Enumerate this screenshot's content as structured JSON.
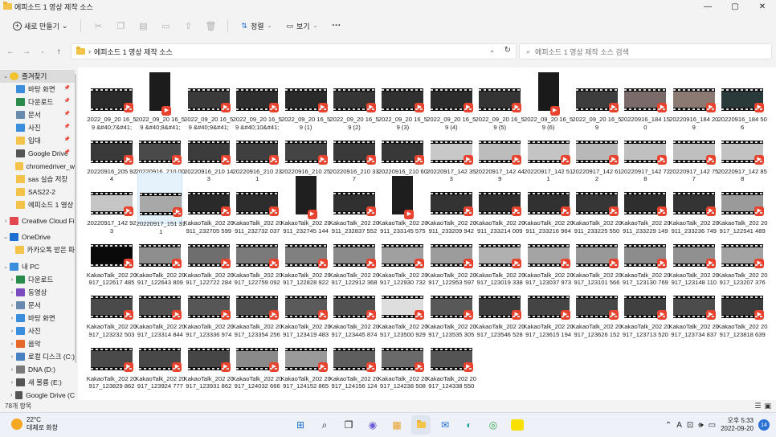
{
  "window": {
    "title": "에피소드 1 영상 제작 소스",
    "min": "—",
    "max": "▢",
    "close": "✕"
  },
  "toolbar": {
    "new": "새로 만들기",
    "sort": "정렬",
    "view": "보기",
    "more": "···"
  },
  "address": {
    "path": "에피소드 1 영상 제작 소스",
    "search_placeholder": "에피소드 1 영상 제작 소스 검색"
  },
  "sidebar": {
    "items": [
      {
        "label": "즐겨찾기",
        "icon": "star-icon",
        "color": "#f4c430",
        "level": 0,
        "arrow": "⌄",
        "selected": true
      },
      {
        "label": "바탕 화면",
        "icon": "desktop-icon",
        "color": "#3b8ede",
        "level": 1,
        "pin": true
      },
      {
        "label": "다운로드",
        "icon": "download-icon",
        "color": "#2a8c4a",
        "level": 1,
        "pin": true
      },
      {
        "label": "문서",
        "icon": "document-icon",
        "color": "#6a8bb0",
        "level": 1,
        "pin": true
      },
      {
        "label": "사진",
        "icon": "picture-icon",
        "color": "#3b8ede",
        "level": 1,
        "pin": true
      },
      {
        "label": "입대",
        "icon": "folder-icon",
        "color": "#f4c34a",
        "level": 1,
        "pin": true
      },
      {
        "label": "Google Drive",
        "icon": "drive-icon",
        "color": "#555555",
        "level": 1,
        "pin": true
      },
      {
        "label": "chromedriver_w",
        "icon": "folder-icon",
        "color": "#f4c34a",
        "level": 1
      },
      {
        "label": "sas 실습 저장",
        "icon": "folder-icon",
        "color": "#f4c34a",
        "level": 1
      },
      {
        "label": "SAS22-2",
        "icon": "folder-icon",
        "color": "#f4c34a",
        "level": 1
      },
      {
        "label": "에피소드 1 영상",
        "icon": "folder-icon",
        "color": "#f4c34a",
        "level": 1
      },
      {
        "label": "Creative Cloud Fi",
        "icon": "cloud-icon",
        "color": "#e34850",
        "level": 0,
        "arrow": "›"
      },
      {
        "label": "OneDrive",
        "icon": "cloud-icon",
        "color": "#1e6fd0",
        "level": 0,
        "arrow": "⌄"
      },
      {
        "label": "카카오톡 받은 파",
        "icon": "folder-icon",
        "color": "#f4c34a",
        "level": 1
      },
      {
        "label": "내 PC",
        "icon": "pc-icon",
        "color": "#3b8ede",
        "level": 0,
        "arrow": "⌄"
      },
      {
        "label": "다운로드",
        "icon": "download-icon",
        "color": "#2a8c4a",
        "level": 1,
        "arrow": "›"
      },
      {
        "label": "동영상",
        "icon": "video-icon",
        "color": "#7c4dbf",
        "level": 1,
        "arrow": "›"
      },
      {
        "label": "문서",
        "icon": "document-icon",
        "color": "#6a8bb0",
        "level": 1,
        "arrow": "›"
      },
      {
        "label": "바탕 화면",
        "icon": "desktop-icon",
        "color": "#3b8ede",
        "level": 1,
        "arrow": "›"
      },
      {
        "label": "사진",
        "icon": "picture-icon",
        "color": "#3b8ede",
        "level": 1,
        "arrow": "›"
      },
      {
        "label": "음악",
        "icon": "music-icon",
        "color": "#e86a2b",
        "level": 1,
        "arrow": "›"
      },
      {
        "label": "로컬 디스크 (C:)",
        "icon": "disk-icon",
        "color": "#4a7fc0",
        "level": 1,
        "arrow": "›"
      },
      {
        "label": "DNA (D:)",
        "icon": "disk-icon",
        "color": "#7a7a7a",
        "level": 1,
        "arrow": "›"
      },
      {
        "label": "새 볼륨 (E:)",
        "icon": "disk-icon",
        "color": "#555555",
        "level": 1,
        "arrow": "›"
      },
      {
        "label": "Google Drive (C",
        "icon": "drive-icon",
        "color": "#555555",
        "level": 1,
        "arrow": "›"
      }
    ]
  },
  "files": [
    {
      "name": "2022_09_20 16_59 &#40;7&#41;",
      "tone": "#2b2b2b",
      "tall": false
    },
    {
      "name": "2022_09_20 16_59 &#40;8&#41;",
      "tone": "#1c1c1c",
      "tall": true
    },
    {
      "name": "2022_09_20 16_59 &#40;9&#41;",
      "tone": "#3a3a3a",
      "tall": false
    },
    {
      "name": "2022_09_20 16_59 &#40;10&#41;",
      "tone": "#2e2e2e",
      "tall": false
    },
    {
      "name": "2022_09_20 16_59 (1)",
      "tone": "#2a2a2a",
      "tall": false
    },
    {
      "name": "2022_09_20 16_59 (2)",
      "tone": "#353535",
      "tall": false
    },
    {
      "name": "2022_09_20 16_59 (3)",
      "tone": "#303030",
      "tall": false
    },
    {
      "name": "2022_09_20 16_59 (4)",
      "tone": "#2c2c2c",
      "tall": false
    },
    {
      "name": "2022_09_20 16_59 (5)",
      "tone": "#343434",
      "tall": false
    },
    {
      "name": "2022_09_20 16_59 (6)",
      "tone": "#1a1a1a",
      "tall": true
    },
    {
      "name": "2022_09_20 16_59",
      "tone": "#3d3d3d",
      "tall": false
    },
    {
      "name": "20220916_184 150",
      "tone": "#7a6a6a",
      "tall": false
    },
    {
      "name": "20220916_184 209",
      "tone": "#8a7a72",
      "tall": false
    },
    {
      "name": "20220916_184 506",
      "tone": "#2a3a3a",
      "tall": false
    },
    {
      "name": "20220916_205 924",
      "tone": "#3a3a3a",
      "tall": false
    },
    {
      "name": "20220916_210 007",
      "tone": "#4a4a4a",
      "tall": false
    },
    {
      "name": "20220916_210 143",
      "tone": "#3c3c3c",
      "tall": false
    },
    {
      "name": "20220916_210 231",
      "tone": "#3f3f3f",
      "tall": false
    },
    {
      "name": "20220916_210 254",
      "tone": "#444444",
      "tall": false
    },
    {
      "name": "20220916_210 337",
      "tone": "#3a3a3a",
      "tall": false
    },
    {
      "name": "20220916_210 600",
      "tone": "#383838",
      "tall": false
    },
    {
      "name": "20220917_142 353",
      "tone": "#c8c8c8",
      "tall": false
    },
    {
      "name": "20220917_142 449",
      "tone": "#bcbcbc",
      "tall": false
    },
    {
      "name": "20220917_142 511",
      "tone": "#c4c4c4",
      "tall": false
    },
    {
      "name": "20220917_142 612",
      "tone": "#b8b8b8",
      "tall": false
    },
    {
      "name": "20220917_142 728",
      "tone": "#c0c0c0",
      "tall": false
    },
    {
      "name": "20220917_142 757",
      "tone": "#bfbfbf",
      "tall": false
    },
    {
      "name": "20220917_142 858",
      "tone": "#c2c2c2",
      "tall": false
    },
    {
      "name": "20220917_142 923",
      "tone": "#c6c6c6",
      "tall": false
    },
    {
      "name": "20220917_151 311",
      "tone": "#a8a8a8",
      "tall": false,
      "selected": true
    },
    {
      "name": "KakaoTalk_202 20911_232705 599",
      "tone": "#2a2a2a",
      "tall": false
    },
    {
      "name": "KakaoTalk_202 20911_232732 037",
      "tone": "#2d2d2d",
      "tall": false
    },
    {
      "name": "KakaoTalk_202 20911_232745 144",
      "tone": "#1f1f1f",
      "tall": true
    },
    {
      "name": "KakaoTalk_202 20911_232837 552",
      "tone": "#303030",
      "tall": false
    },
    {
      "name": "KakaoTalk_202 20911_233145 575",
      "tone": "#1e1e1e",
      "tall": true
    },
    {
      "name": "KakaoTalk_202 20911_233209 942",
      "tone": "#333333",
      "tall": false
    },
    {
      "name": "KakaoTalk_202 20911_233214 009",
      "tone": "#2f2f2f",
      "tall": false
    },
    {
      "name": "KakaoTalk_202 20911_233216 964",
      "tone": "#313131",
      "tall": false
    },
    {
      "name": "KakaoTalk_202 20911_233225 550",
      "tone": "#363636",
      "tall": false
    },
    {
      "name": "KakaoTalk_202 20911_233229 149",
      "tone": "#2e2e2e",
      "tall": false
    },
    {
      "name": "KakaoTalk_202 20911_233236 749",
      "tone": "#343434",
      "tall": false
    },
    {
      "name": "KakaoTalk_202 20917_122541 489",
      "tone": "#9a9a9a",
      "tall": false
    },
    {
      "name": "KakaoTalk_202 20917_122617 485",
      "tone": "#0a0a0a",
      "tall": false
    },
    {
      "name": "KakaoTalk_202 20917_122643 809",
      "tone": "#8e8e8e",
      "tall": false
    },
    {
      "name": "KakaoTalk_202 20917_122722 284",
      "tone": "#6e6e6e",
      "tall": false
    },
    {
      "name": "KakaoTalk_202 20917_122759 092",
      "tone": "#7a7a7a",
      "tall": false
    },
    {
      "name": "KakaoTalk_202 20917_122828 922",
      "tone": "#808080",
      "tall": false
    },
    {
      "name": "KakaoTalk_202 20917_122912 368",
      "tone": "#8a8a8a",
      "tall": false
    },
    {
      "name": "KakaoTalk_202 20917_122930 732",
      "tone": "#a0a0a0",
      "tall": false
    },
    {
      "name": "KakaoTalk_202 20917_122953 597",
      "tone": "#9c9c9c",
      "tall": false
    },
    {
      "name": "KakaoTalk_202 20917_123019 338",
      "tone": "#b0b0b0",
      "tall": false
    },
    {
      "name": "KakaoTalk_202 20917_123037 973",
      "tone": "#a4a4a4",
      "tall": false
    },
    {
      "name": "KakaoTalk_202 20917_123101 566",
      "tone": "#989898",
      "tall": false
    },
    {
      "name": "KakaoTalk_202 20917_123130 769",
      "tone": "#8c8c8c",
      "tall": false
    },
    {
      "name": "KakaoTalk_202 20917_123148 110",
      "tone": "#909090",
      "tall": false
    },
    {
      "name": "KakaoTalk_202 20917_123207 376",
      "tone": "#a2a2a2",
      "tall": false
    },
    {
      "name": "KakaoTalk_202 20917_123232 503",
      "tone": "#4a4a4a",
      "tall": false
    },
    {
      "name": "KakaoTalk_202 20917_123314 844",
      "tone": "#505050",
      "tall": false
    },
    {
      "name": "KakaoTalk_202 20917_123336 974",
      "tone": "#565656",
      "tall": false
    },
    {
      "name": "KakaoTalk_202 20917_123354 256",
      "tone": "#4e4e4e",
      "tall": false
    },
    {
      "name": "KakaoTalk_202 20917_123419 483",
      "tone": "#5a5a5a",
      "tall": false
    },
    {
      "name": "KakaoTalk_202 20917_123445 874",
      "tone": "#525252",
      "tall": false
    },
    {
      "name": "KakaoTalk_202 20917_123500 929",
      "tone": "#dedede",
      "tall": false
    },
    {
      "name": "KakaoTalk_202 20917_123535 305",
      "tone": "#585858",
      "tall": false
    },
    {
      "name": "KakaoTalk_202 20917_123546 528",
      "tone": "#3e3e3e",
      "tall": false
    },
    {
      "name": "KakaoTalk_202 20917_123615 194",
      "tone": "#444444",
      "tall": false
    },
    {
      "name": "KakaoTalk_202 20917_123626 152",
      "tone": "#464646",
      "tall": false
    },
    {
      "name": "KakaoTalk_202 20917_123713 520",
      "tone": "#404040",
      "tall": false
    },
    {
      "name": "KakaoTalk_202 20917_123734 837",
      "tone": "#4c4c4c",
      "tall": false
    },
    {
      "name": "KakaoTalk_202 20917_123818 639",
      "tone": "#3c3c3c",
      "tall": false
    },
    {
      "name": "KakaoTalk_202 20917_123829 862",
      "tone": "#4a4a4a",
      "tall": false
    },
    {
      "name": "KakaoTalk_202 20917_123924 777",
      "tone": "#484848",
      "tall": false
    },
    {
      "name": "KakaoTalk_202 20917_123931 862",
      "tone": "#464646",
      "tall": false
    },
    {
      "name": "KakaoTalk_202 20917_124032 666",
      "tone": "#8a8a8a",
      "tall": false
    },
    {
      "name": "KakaoTalk_202 20917_124152 865",
      "tone": "#9a9a9a",
      "tall": false
    },
    {
      "name": "KakaoTalk_202 20917_124156 124",
      "tone": "#5e5e5e",
      "tall": false
    },
    {
      "name": "KakaoTalk_202 20917_124238 508",
      "tone": "#6a6a6a",
      "tall": false
    },
    {
      "name": "KakaoTalk_202 20917_124338 550",
      "tone": "#545454",
      "tall": false
    }
  ],
  "status": {
    "count": "78개 항목"
  },
  "taskbar": {
    "temp": "22°C",
    "weather": "대체로 화창",
    "time": "오후 5:33",
    "date": "2022-09-20",
    "ime": "A",
    "notif": "14"
  },
  "colors": {
    "badge": "#e8432f",
    "accent": "#2b72d6"
  }
}
